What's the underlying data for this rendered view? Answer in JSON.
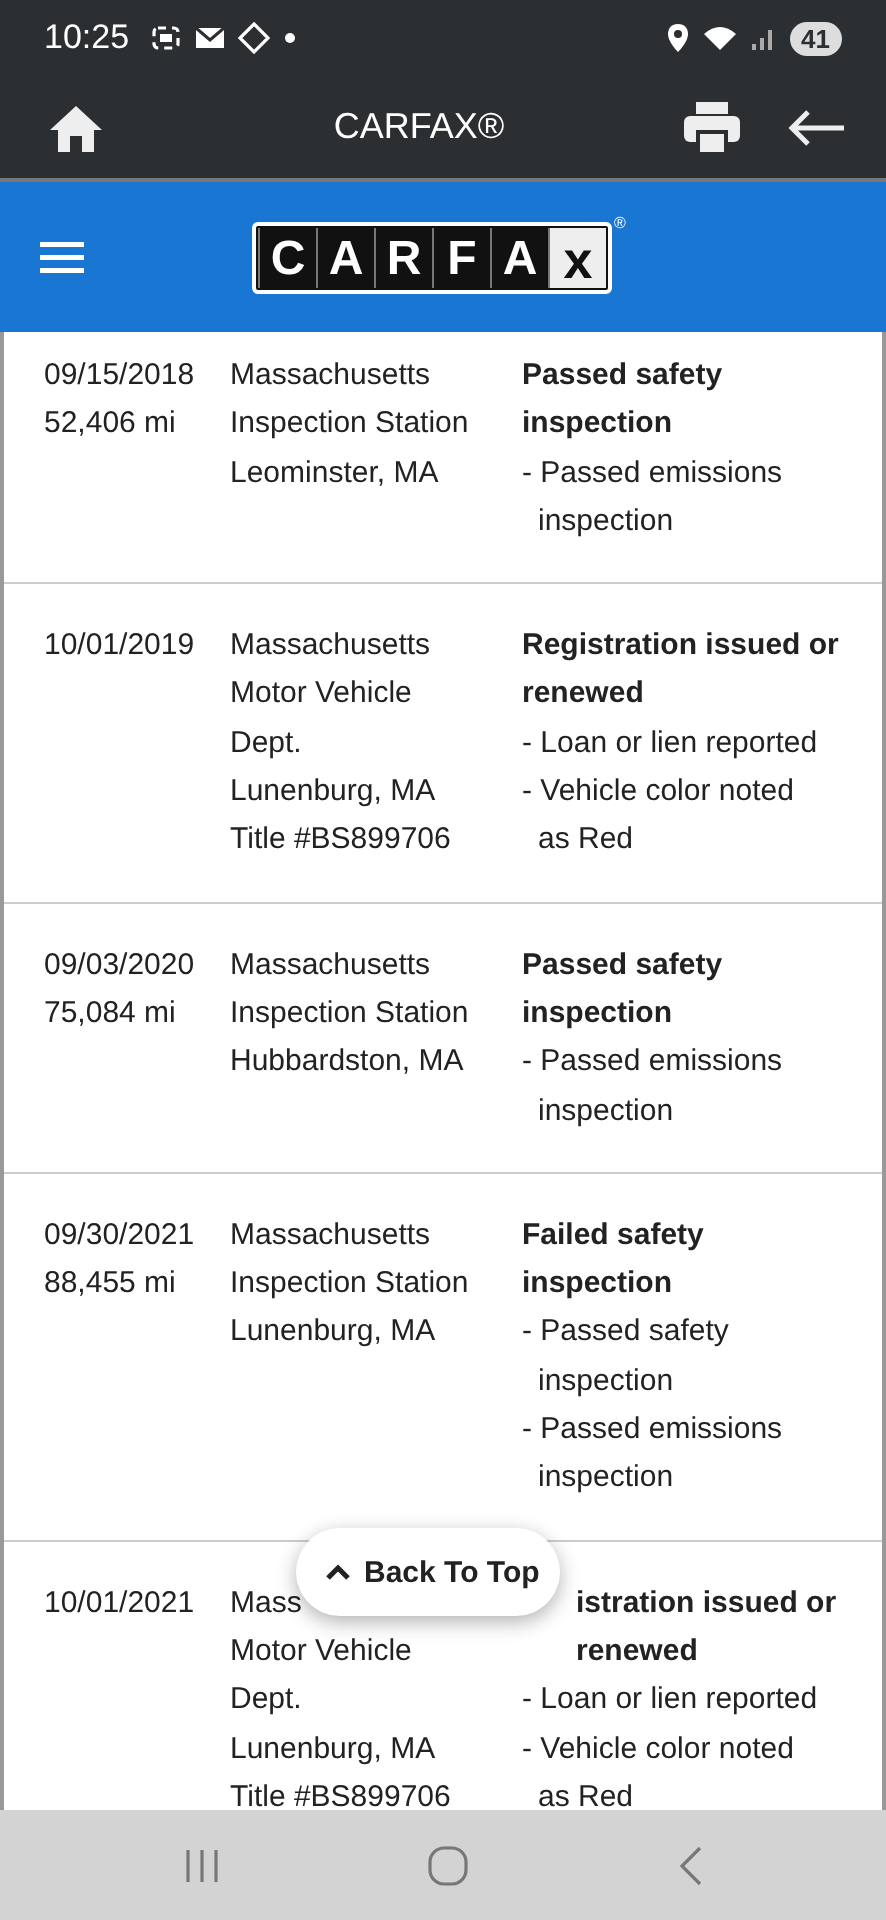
{
  "status_bar": {
    "time": "10:25",
    "battery": "41"
  },
  "app_bar": {
    "title": "CARFAX®"
  },
  "header": {
    "logo_letters": [
      "C",
      "A",
      "R",
      "F",
      "A",
      "x"
    ],
    "logo_mark": "®"
  },
  "records": [
    {
      "date": "09/15/2018",
      "mileage": "52,406 mi",
      "location": [
        "Massachusetts",
        "Inspection Station",
        "Leominster, MA"
      ],
      "event": "Passed safety inspection",
      "covered": false,
      "details": [
        "- Passed emissions inspection"
      ]
    },
    {
      "date": "10/01/2019",
      "location": [
        "Massachusetts",
        "Motor Vehicle",
        "Dept.",
        "Lunenburg, MA",
        "Title #BS899706"
      ],
      "event": "Registration issued or renewed",
      "covered": false,
      "details": [
        "- Loan or lien reported",
        "- Vehicle color noted as Red"
      ]
    },
    {
      "date": "09/03/2020",
      "mileage": "75,084 mi",
      "location": [
        "Massachusetts",
        "Inspection Station",
        "Hubbardston, MA"
      ],
      "event": "Passed safety inspection",
      "covered": false,
      "details": [
        "- Passed emissions inspection"
      ]
    },
    {
      "date": "09/30/2021",
      "mileage": "88,455 mi",
      "location": [
        "Massachusetts",
        "Inspection Station",
        "Lunenburg, MA"
      ],
      "event": "Failed safety inspection",
      "covered": false,
      "details": [
        "- Passed safety inspection",
        "- Passed emissions inspection"
      ]
    },
    {
      "date": "10/01/2021",
      "location": [
        "Mass",
        "Motor Vehicle",
        "Dept.",
        "Lunenburg, MA",
        "Title #BS899706"
      ],
      "event": "istration issued or renewed",
      "covered": true,
      "details": [
        "- Loan or lien reported",
        "- Vehicle color noted as Red"
      ]
    }
  ],
  "back_to_top": {
    "label": "Back To Top"
  }
}
